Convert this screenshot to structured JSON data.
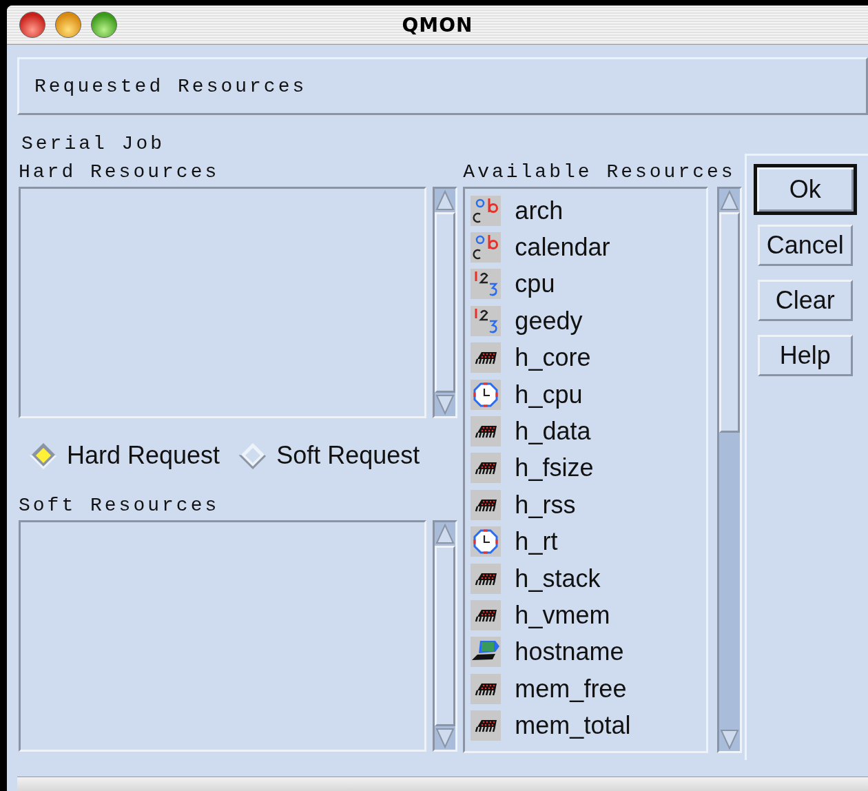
{
  "window": {
    "title": "QMON"
  },
  "header": "Requested Resources",
  "job_type": "Serial Job",
  "hard_resources": {
    "label": "Hard Resources"
  },
  "request_type": [
    {
      "label": "Hard Request",
      "selected": true
    },
    {
      "label": "Soft Request",
      "selected": false
    }
  ],
  "soft_resources": {
    "label": "Soft Resources"
  },
  "available_resources": {
    "label": "Available Resources",
    "items": [
      {
        "name": "arch",
        "kind": "string"
      },
      {
        "name": "calendar",
        "kind": "string"
      },
      {
        "name": "cpu",
        "kind": "number"
      },
      {
        "name": "geedy",
        "kind": "number"
      },
      {
        "name": "h_core",
        "kind": "memory"
      },
      {
        "name": "h_cpu",
        "kind": "time"
      },
      {
        "name": "h_data",
        "kind": "memory"
      },
      {
        "name": "h_fsize",
        "kind": "memory"
      },
      {
        "name": "h_rss",
        "kind": "memory"
      },
      {
        "name": "h_rt",
        "kind": "time"
      },
      {
        "name": "h_stack",
        "kind": "memory"
      },
      {
        "name": "h_vmem",
        "kind": "memory"
      },
      {
        "name": "hostname",
        "kind": "host"
      },
      {
        "name": "mem_free",
        "kind": "memory"
      },
      {
        "name": "mem_total",
        "kind": "memory"
      }
    ]
  },
  "buttons": [
    {
      "label": "Ok",
      "default": true
    },
    {
      "label": "Cancel",
      "default": false
    },
    {
      "label": "Clear",
      "default": false
    },
    {
      "label": "Help",
      "default": false
    }
  ]
}
